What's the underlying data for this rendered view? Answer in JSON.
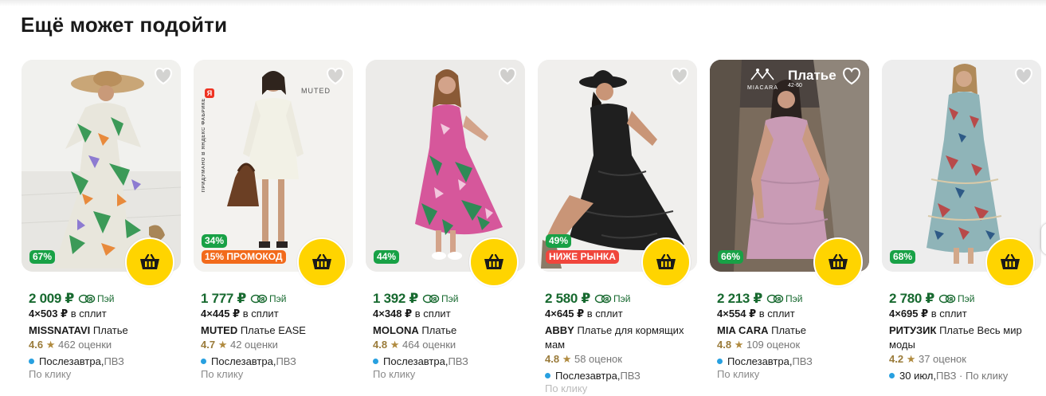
{
  "section": {
    "title": "Ещё может подойти"
  },
  "colors": {
    "price_green": "#17692f",
    "discount_green": "#18a146",
    "promo_orange": "#f26a1b",
    "market_red": "#f0463c",
    "cart_yellow": "#ffd400",
    "delivery_blue": "#28a0e0"
  },
  "cards": [
    {
      "image": "woman in floral maxi dress and wide straw hat",
      "badges": [
        {
          "text": "67%",
          "kind": "green"
        }
      ],
      "price": "2 009 ₽",
      "pay_label": "Пэй",
      "split_prefix": "4×503 ₽",
      "split_suffix": " в сплит",
      "brand": "MISSNATAVI",
      "name": " Платье",
      "rating": "4.6",
      "star": "★",
      "reviews": "462 оценки",
      "delivery_main": "Послезавтра,",
      "delivery_rest": " ПВЗ",
      "sub": "По клику"
    },
    {
      "image": "woman in white knit dress with brown bag",
      "badges": [
        {
          "text": "34%",
          "kind": "green"
        },
        {
          "text": "15% ПРОМОКОД",
          "kind": "orange"
        }
      ],
      "price": "1 777 ₽",
      "pay_label": "Пэй",
      "split_prefix": "4×445 ₽",
      "split_suffix": " в сплит",
      "brand": "MUTED",
      "name": " Платье EASE",
      "rating": "4.7",
      "star": "★",
      "reviews": "42 оценки",
      "delivery_main": "Послезавтра,",
      "delivery_rest": " ПВЗ",
      "sub": "По клику",
      "overlay": {
        "brand_label": "MUTED",
        "ya": "Я",
        "vertical": "ПРИДУМАНО В ЯНДЕКС ФАБРИКЕ"
      }
    },
    {
      "image": "woman in pink floral tiered dress",
      "badges": [
        {
          "text": "44%",
          "kind": "green"
        }
      ],
      "price": "1 392 ₽",
      "pay_label": "Пэй",
      "split_prefix": "4×348 ₽",
      "split_suffix": " в сплит",
      "brand": "MOLONA",
      "name": " Платье",
      "rating": "4.8",
      "star": "★",
      "reviews": "464 оценки",
      "delivery_main": "Послезавтра,",
      "delivery_rest": " ПВЗ",
      "sub": "По клику"
    },
    {
      "image": "woman in black lace dress and black hat",
      "badges": [
        {
          "text": "49%",
          "kind": "green"
        },
        {
          "text": "НИЖЕ РЫНКА",
          "kind": "red"
        }
      ],
      "price": "2 580 ₽",
      "pay_label": "Пэй",
      "split_prefix": "4×645 ₽",
      "split_suffix": " в сплит",
      "brand": "ABBY",
      "name": " Платье для кормящих мам",
      "rating": "4.8",
      "star": "★",
      "reviews": "58 оценок",
      "delivery_main": "Послезавтра,",
      "delivery_rest": " ПВЗ",
      "sub": "По клику"
    },
    {
      "image": "woman in pink dress by a palm tree",
      "badges": [
        {
          "text": "66%",
          "kind": "green"
        }
      ],
      "price": "2 213 ₽",
      "pay_label": "Пэй",
      "split_prefix": "4×554 ₽",
      "split_suffix": " в сплит",
      "brand": "MIA CARA",
      "name": " Платье",
      "rating": "4.8",
      "star": "★",
      "reviews": "109 оценок",
      "delivery_main": "Послезавтра,",
      "delivery_rest": " ПВЗ",
      "sub": "По клику",
      "overlay": {
        "logo_word": "MIACARA",
        "title": "Платье",
        "size": "42-60"
      }
    },
    {
      "image": "woman in patterned boho maxi dress",
      "badges": [
        {
          "text": "68%",
          "kind": "green"
        }
      ],
      "price": "2 780 ₽",
      "pay_label": "Пэй",
      "split_prefix": "4×695 ₽",
      "split_suffix": " в сплит",
      "brand": "РИТУЗИК",
      "name": " Платье Весь мир моды",
      "rating": "4.2",
      "star": "★",
      "reviews": "37 оценок",
      "delivery_main": "30 июл,",
      "delivery_rest": " ПВЗ · По клику",
      "sub": ""
    }
  ]
}
